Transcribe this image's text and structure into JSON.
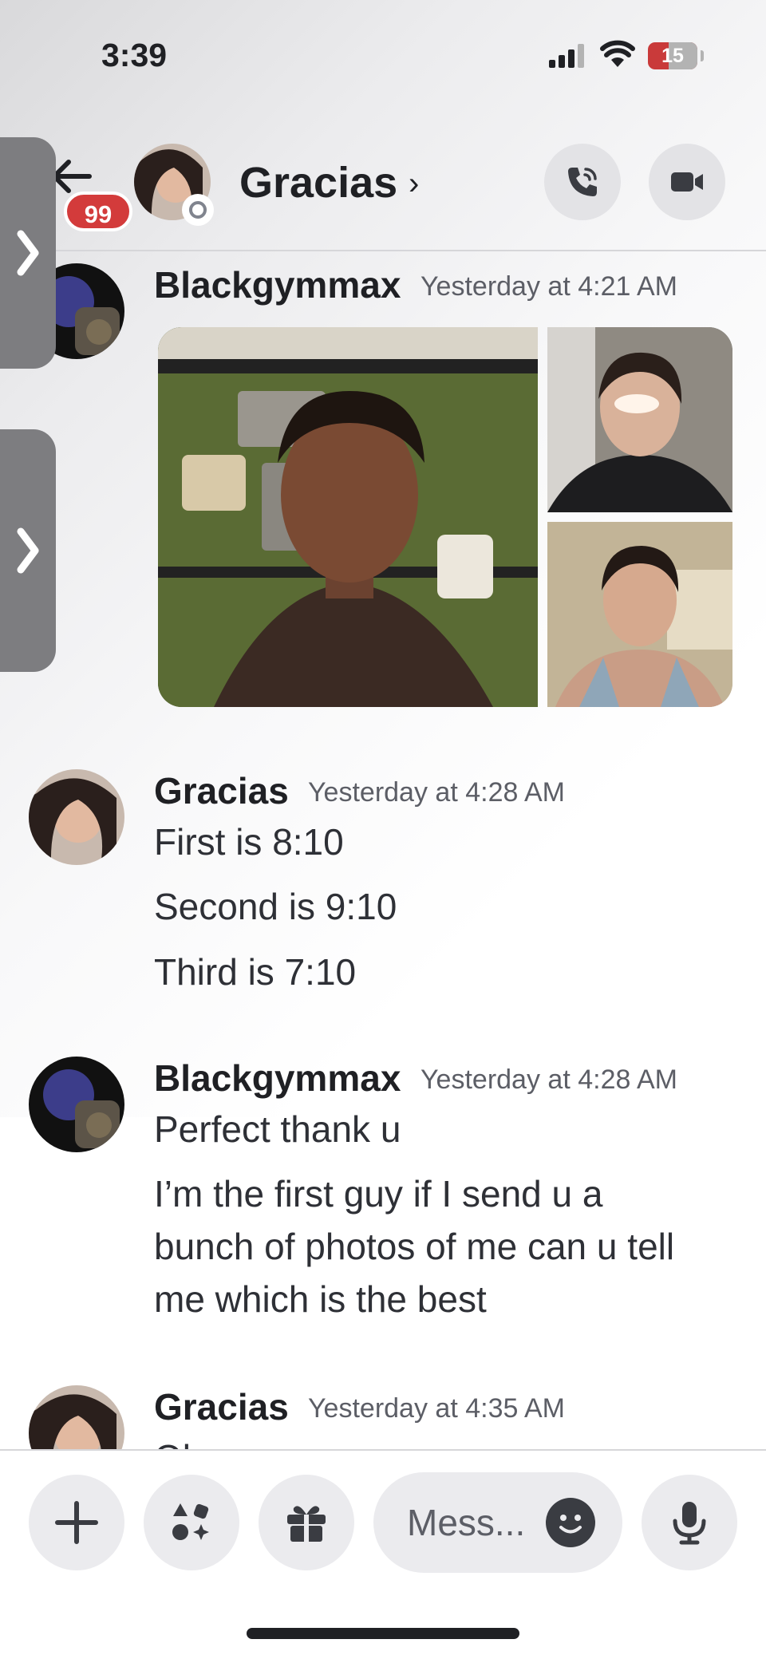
{
  "status_bar": {
    "time": "3:39",
    "battery": "15"
  },
  "header": {
    "badge": "99",
    "name": "Gracias",
    "chevron": "›"
  },
  "messages": [
    {
      "author": "Blackgymmax",
      "timestamp": "Yesterday at 4:21 AM",
      "lines": []
    },
    {
      "author": "Gracias",
      "timestamp": "Yesterday at 4:28 AM",
      "lines": [
        "First is 8:10",
        "Second is 9:10",
        "Third is 7:10"
      ]
    },
    {
      "author": "Blackgymmax",
      "timestamp": "Yesterday at 4:28 AM",
      "lines": [
        "Perfect thank u",
        "I’m the first guy if I send u a",
        "bunch of photos of me can u tell",
        "me which is the best"
      ]
    },
    {
      "author": "Gracias",
      "timestamp": "Yesterday at 4:35 AM",
      "lines": [
        "Ok"
      ]
    }
  ],
  "composer": {
    "placeholder": "Mess..."
  },
  "icons": {
    "back": "arrow-left-icon",
    "call": "phone-icon",
    "video": "video-camera-icon",
    "plus": "plus-icon",
    "apps": "apps-icon",
    "gift": "gift-icon",
    "emoji": "emoji-icon",
    "mic": "microphone-icon",
    "drawer": "chevron-right-icon"
  },
  "colors": {
    "badge": "#d33b3b",
    "battery_low": "#c93a3a",
    "button_bg": "#e3e3e6"
  }
}
